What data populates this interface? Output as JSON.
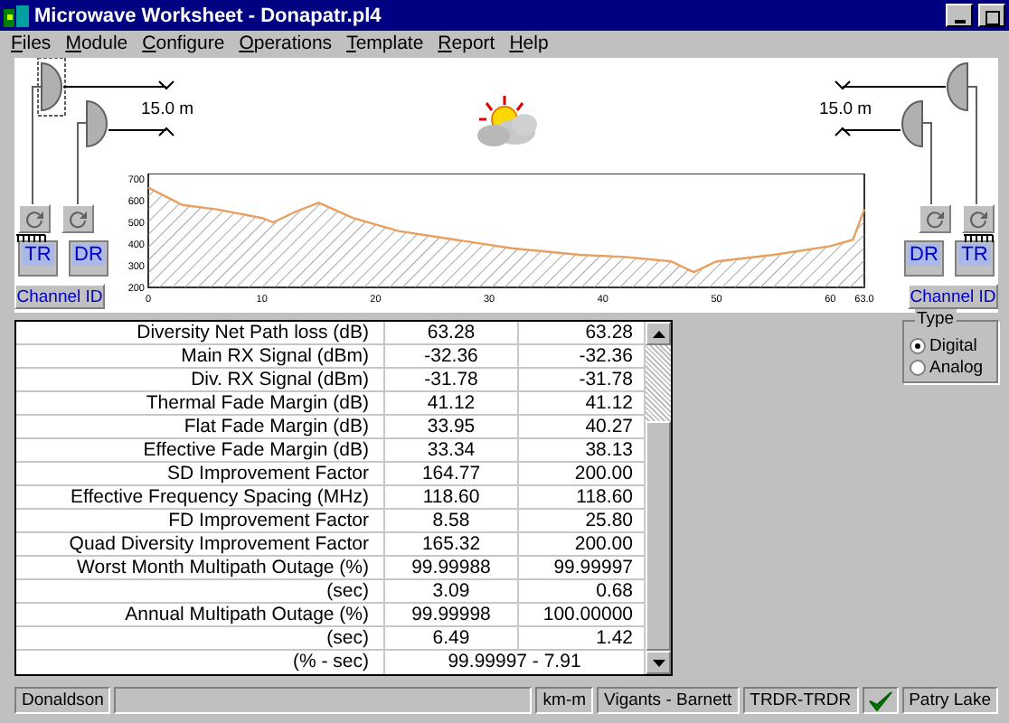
{
  "window": {
    "title": "Microwave Worksheet - Donapatr.pl4"
  },
  "menu": [
    "Files",
    "Module",
    "Configure",
    "Operations",
    "Template",
    "Report",
    "Help"
  ],
  "diagram": {
    "left_antennas": [
      {
        "selected": true
      },
      {
        "selected": false
      }
    ],
    "right_antennas": [
      {
        "selected": false
      },
      {
        "selected": false
      }
    ],
    "left_height": "15.0 m",
    "right_height": "15.0 m",
    "left_units": [
      "TR",
      "DR"
    ],
    "left_channel": "Channel ID",
    "right_units": [
      "DR",
      "TR"
    ],
    "right_channel": "Channel ID",
    "profile": {
      "chart_data": {
        "type": "area",
        "x": [
          0,
          3,
          6,
          10,
          11,
          13,
          15,
          18,
          22,
          27,
          32,
          38,
          42,
          46,
          48,
          50,
          55,
          60,
          62,
          63
        ],
        "series": [
          {
            "color": "#e8a060",
            "values": [
              660,
              580,
              560,
              520,
              500,
              550,
              590,
              520,
              460,
              420,
              380,
              350,
              340,
              320,
              270,
              320,
              350,
              390,
              420,
              560
            ]
          }
        ],
        "xlim": [
          0,
          63
        ],
        "ylim": [
          200,
          700
        ],
        "xticks": [
          0,
          10,
          20,
          30,
          40,
          50,
          60,
          {
            "value": 63,
            "label": "63.0"
          }
        ],
        "yticks": [
          200,
          300,
          400,
          500,
          600,
          700
        ]
      }
    }
  },
  "table": {
    "rows": [
      {
        "kind": "pair",
        "label": "Diversity Net Path loss (dB)",
        "values": [
          "63.28",
          "63.28"
        ]
      },
      {
        "kind": "pair",
        "label": "Main RX Signal (dBm)",
        "values": [
          "-32.36",
          "-32.36"
        ]
      },
      {
        "kind": "pair",
        "label": "Div. RX Signal (dBm)",
        "values": [
          "-31.78",
          "-31.78"
        ]
      },
      {
        "kind": "pair",
        "label": "Thermal Fade Margin (dB)",
        "values": [
          "41.12",
          "41.12"
        ]
      },
      {
        "kind": "pair",
        "label": "Flat Fade Margin (dB)",
        "values": [
          "33.95",
          "40.27"
        ]
      },
      {
        "kind": "pair",
        "label": "Effective Fade Margin (dB)",
        "values": [
          "33.34",
          "38.13"
        ]
      },
      {
        "kind": "pair",
        "label": "SD Improvement Factor",
        "values": [
          "164.77",
          "200.00"
        ]
      },
      {
        "kind": "pair",
        "label": "Effective Frequency Spacing (MHz)",
        "values": [
          "118.60",
          "118.60"
        ]
      },
      {
        "kind": "pair",
        "label": "FD Improvement Factor",
        "values": [
          "8.58",
          "25.80"
        ]
      },
      {
        "kind": "pair",
        "label": "Quad Diversity Improvement Factor",
        "values": [
          "165.32",
          "200.00"
        ]
      },
      {
        "kind": "pair",
        "label": "Worst Month Multipath Outage (%)",
        "values": [
          "99.99988",
          "99.99997"
        ]
      },
      {
        "kind": "pair",
        "label": "(sec)",
        "values": [
          "3.09",
          "0.68"
        ]
      },
      {
        "kind": "pair",
        "label": "Annual Multipath Outage (%)",
        "values": [
          "99.99998",
          "100.00000"
        ]
      },
      {
        "kind": "pair",
        "label": "(sec)",
        "values": [
          "6.49",
          "1.42"
        ]
      },
      {
        "kind": "merged",
        "label": "(% - sec)",
        "values": [
          "99.99997 - 7.91"
        ]
      }
    ]
  },
  "type_group": {
    "title": "Type",
    "options": [
      {
        "label": "Digital",
        "selected": true
      },
      {
        "label": "Analog",
        "selected": false
      }
    ]
  },
  "status_bar": [
    {
      "kind": "text",
      "text": "Donaldson"
    },
    {
      "kind": "blank"
    },
    {
      "kind": "text",
      "text": "km-m"
    },
    {
      "kind": "text",
      "text": "Vigants - Barnett"
    },
    {
      "kind": "text",
      "text": "TRDR-TRDR"
    },
    {
      "kind": "check"
    },
    {
      "kind": "text",
      "text": "Patry Lake"
    }
  ]
}
